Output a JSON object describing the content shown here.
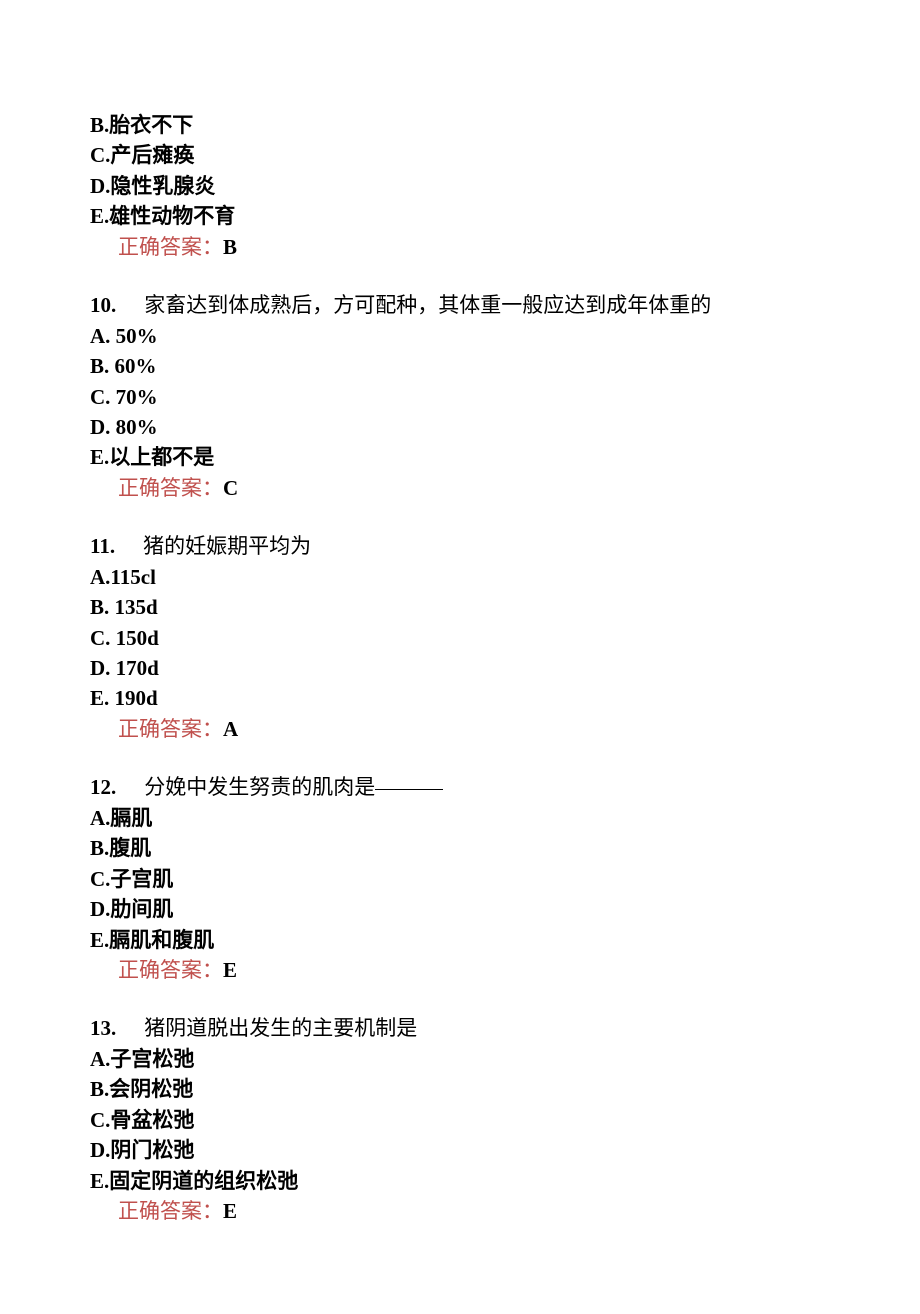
{
  "q9_partial": {
    "options": [
      {
        "label": "B.",
        "text": "胎衣不下"
      },
      {
        "label": "C.",
        "text": "产后瘫痪"
      },
      {
        "label": "D.",
        "text": "隐性乳腺炎"
      },
      {
        "label": "E.",
        "text": "雄性动物不育"
      }
    ],
    "answer_label": "正确答案：",
    "answer": "B"
  },
  "q10": {
    "num": "10.",
    "stem": "家畜达到体成熟后，方可配种，其体重一般应达到成年体重的",
    "options": [
      {
        "label": "A.",
        "text": "50%"
      },
      {
        "label": "B.",
        "text": "60%"
      },
      {
        "label": "C.",
        "text": "70%"
      },
      {
        "label": "D.",
        "text": "80%"
      },
      {
        "label": "E.",
        "text": "以上都不是"
      }
    ],
    "answer_label": "正确答案：",
    "answer": "C"
  },
  "q11": {
    "num": "11.",
    "stem": "猪的妊娠期平均为",
    "options": [
      {
        "label": "A.",
        "text": "115cl"
      },
      {
        "label": "B.",
        "text": "135d"
      },
      {
        "label": "C.",
        "text": "150d"
      },
      {
        "label": "D.",
        "text": "170d"
      },
      {
        "label": "E.",
        "text": "190d"
      }
    ],
    "answer_label": "正确答案：",
    "answer": "A"
  },
  "q12": {
    "num": "12.",
    "stem": "分娩中发生努责的肌肉是",
    "options": [
      {
        "label": "A.",
        "text": "膈肌"
      },
      {
        "label": "B.",
        "text": "腹肌"
      },
      {
        "label": "C.",
        "text": "子宫肌"
      },
      {
        "label": "D.",
        "text": "肋间肌"
      },
      {
        "label": "E.",
        "text": "膈肌和腹肌"
      }
    ],
    "answer_label": "正确答案：",
    "answer": "E"
  },
  "q13": {
    "num": "13.",
    "stem": "猪阴道脱出发生的主要机制是",
    "options": [
      {
        "label": "A.",
        "text": "子宫松弛"
      },
      {
        "label": "B.",
        "text": "会阴松弛"
      },
      {
        "label": "C.",
        "text": "骨盆松弛"
      },
      {
        "label": "D.",
        "text": "阴门松弛"
      },
      {
        "label": "E.",
        "text": "固定阴道的组织松弛"
      }
    ],
    "answer_label": "正确答案：",
    "answer": "E"
  }
}
